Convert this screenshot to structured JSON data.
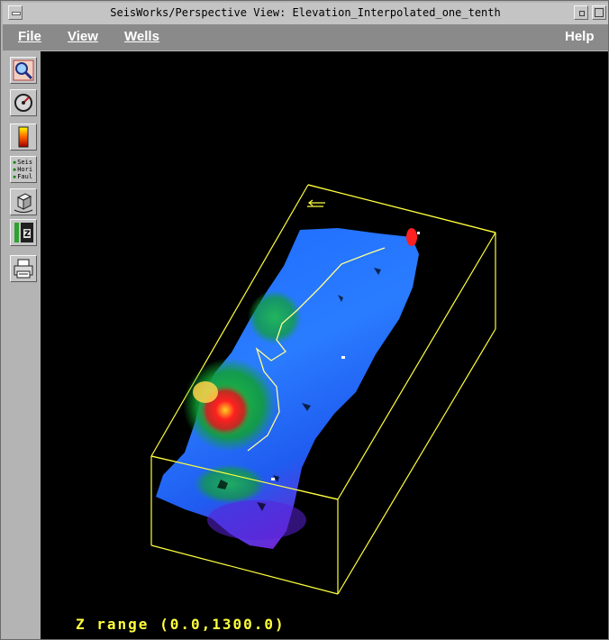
{
  "window": {
    "title": "SeisWorks/Perspective View: Elevation_Interpolated_one_tenth"
  },
  "menubar": {
    "file": "File",
    "view": "View",
    "wells": "Wells",
    "help": "Help"
  },
  "toolbar": {
    "tools": [
      {
        "icon": "zoom-magnifier-icon"
      },
      {
        "icon": "rotate-gauge-icon"
      },
      {
        "icon": "color-scale-icon"
      },
      {
        "icon": "layers-seis-hori-faul-icon",
        "lines": [
          "Seis",
          "Hori",
          "Faul"
        ]
      },
      {
        "icon": "cube-view-icon"
      },
      {
        "icon": "z-scale-icon",
        "label": "Z"
      },
      {
        "icon": "printer-icon"
      }
    ]
  },
  "view": {
    "z_range_label": "Z range (0.0,1300.0)",
    "colors": {
      "background": "#000000",
      "bounding_box": "#ffff3c",
      "surface_low": "#7a1fd0",
      "surface_mid": "#1f7aff",
      "surface_high": "#ff2020"
    }
  }
}
